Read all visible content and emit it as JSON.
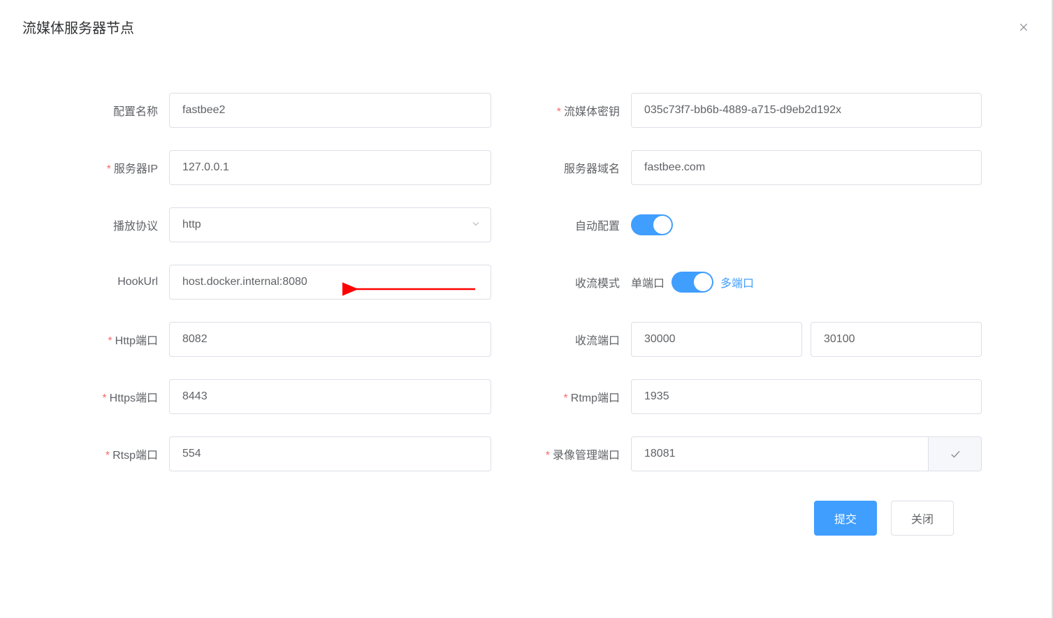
{
  "dialog": {
    "title": "流媒体服务器节点"
  },
  "labels": {
    "configName": "配置名称",
    "serverIp": "服务器IP",
    "playProtocol": "播放协议",
    "hookUrl": "HookUrl",
    "httpPort": "Http端口",
    "httpsPort": "Https端口",
    "rtspPort": "Rtsp端口",
    "mediaSecret": "流媒体密钥",
    "serverDomain": "服务器域名",
    "autoConfig": "自动配置",
    "streamMode": "收流模式",
    "streamPort": "收流端口",
    "rtmpPort": "Rtmp端口",
    "recordPort": "录像管理端口"
  },
  "values": {
    "configName": "fastbee2",
    "serverIp": "127.0.0.1",
    "playProtocol": "http",
    "hookUrl": "host.docker.internal:8080",
    "httpPort": "8082",
    "httpsPort": "8443",
    "rtspPort": "554",
    "mediaSecret": "035c73f7-bb6b-4889-a715-d9eb2d192x",
    "serverDomain": "fastbee.com",
    "streamModeLeft": "单端口",
    "streamModeRight": "多端口",
    "streamPortStart": "30000",
    "streamPortEnd": "30100",
    "rtmpPort": "1935",
    "recordPort": "18081"
  },
  "buttons": {
    "submit": "提交",
    "close": "关闭"
  }
}
